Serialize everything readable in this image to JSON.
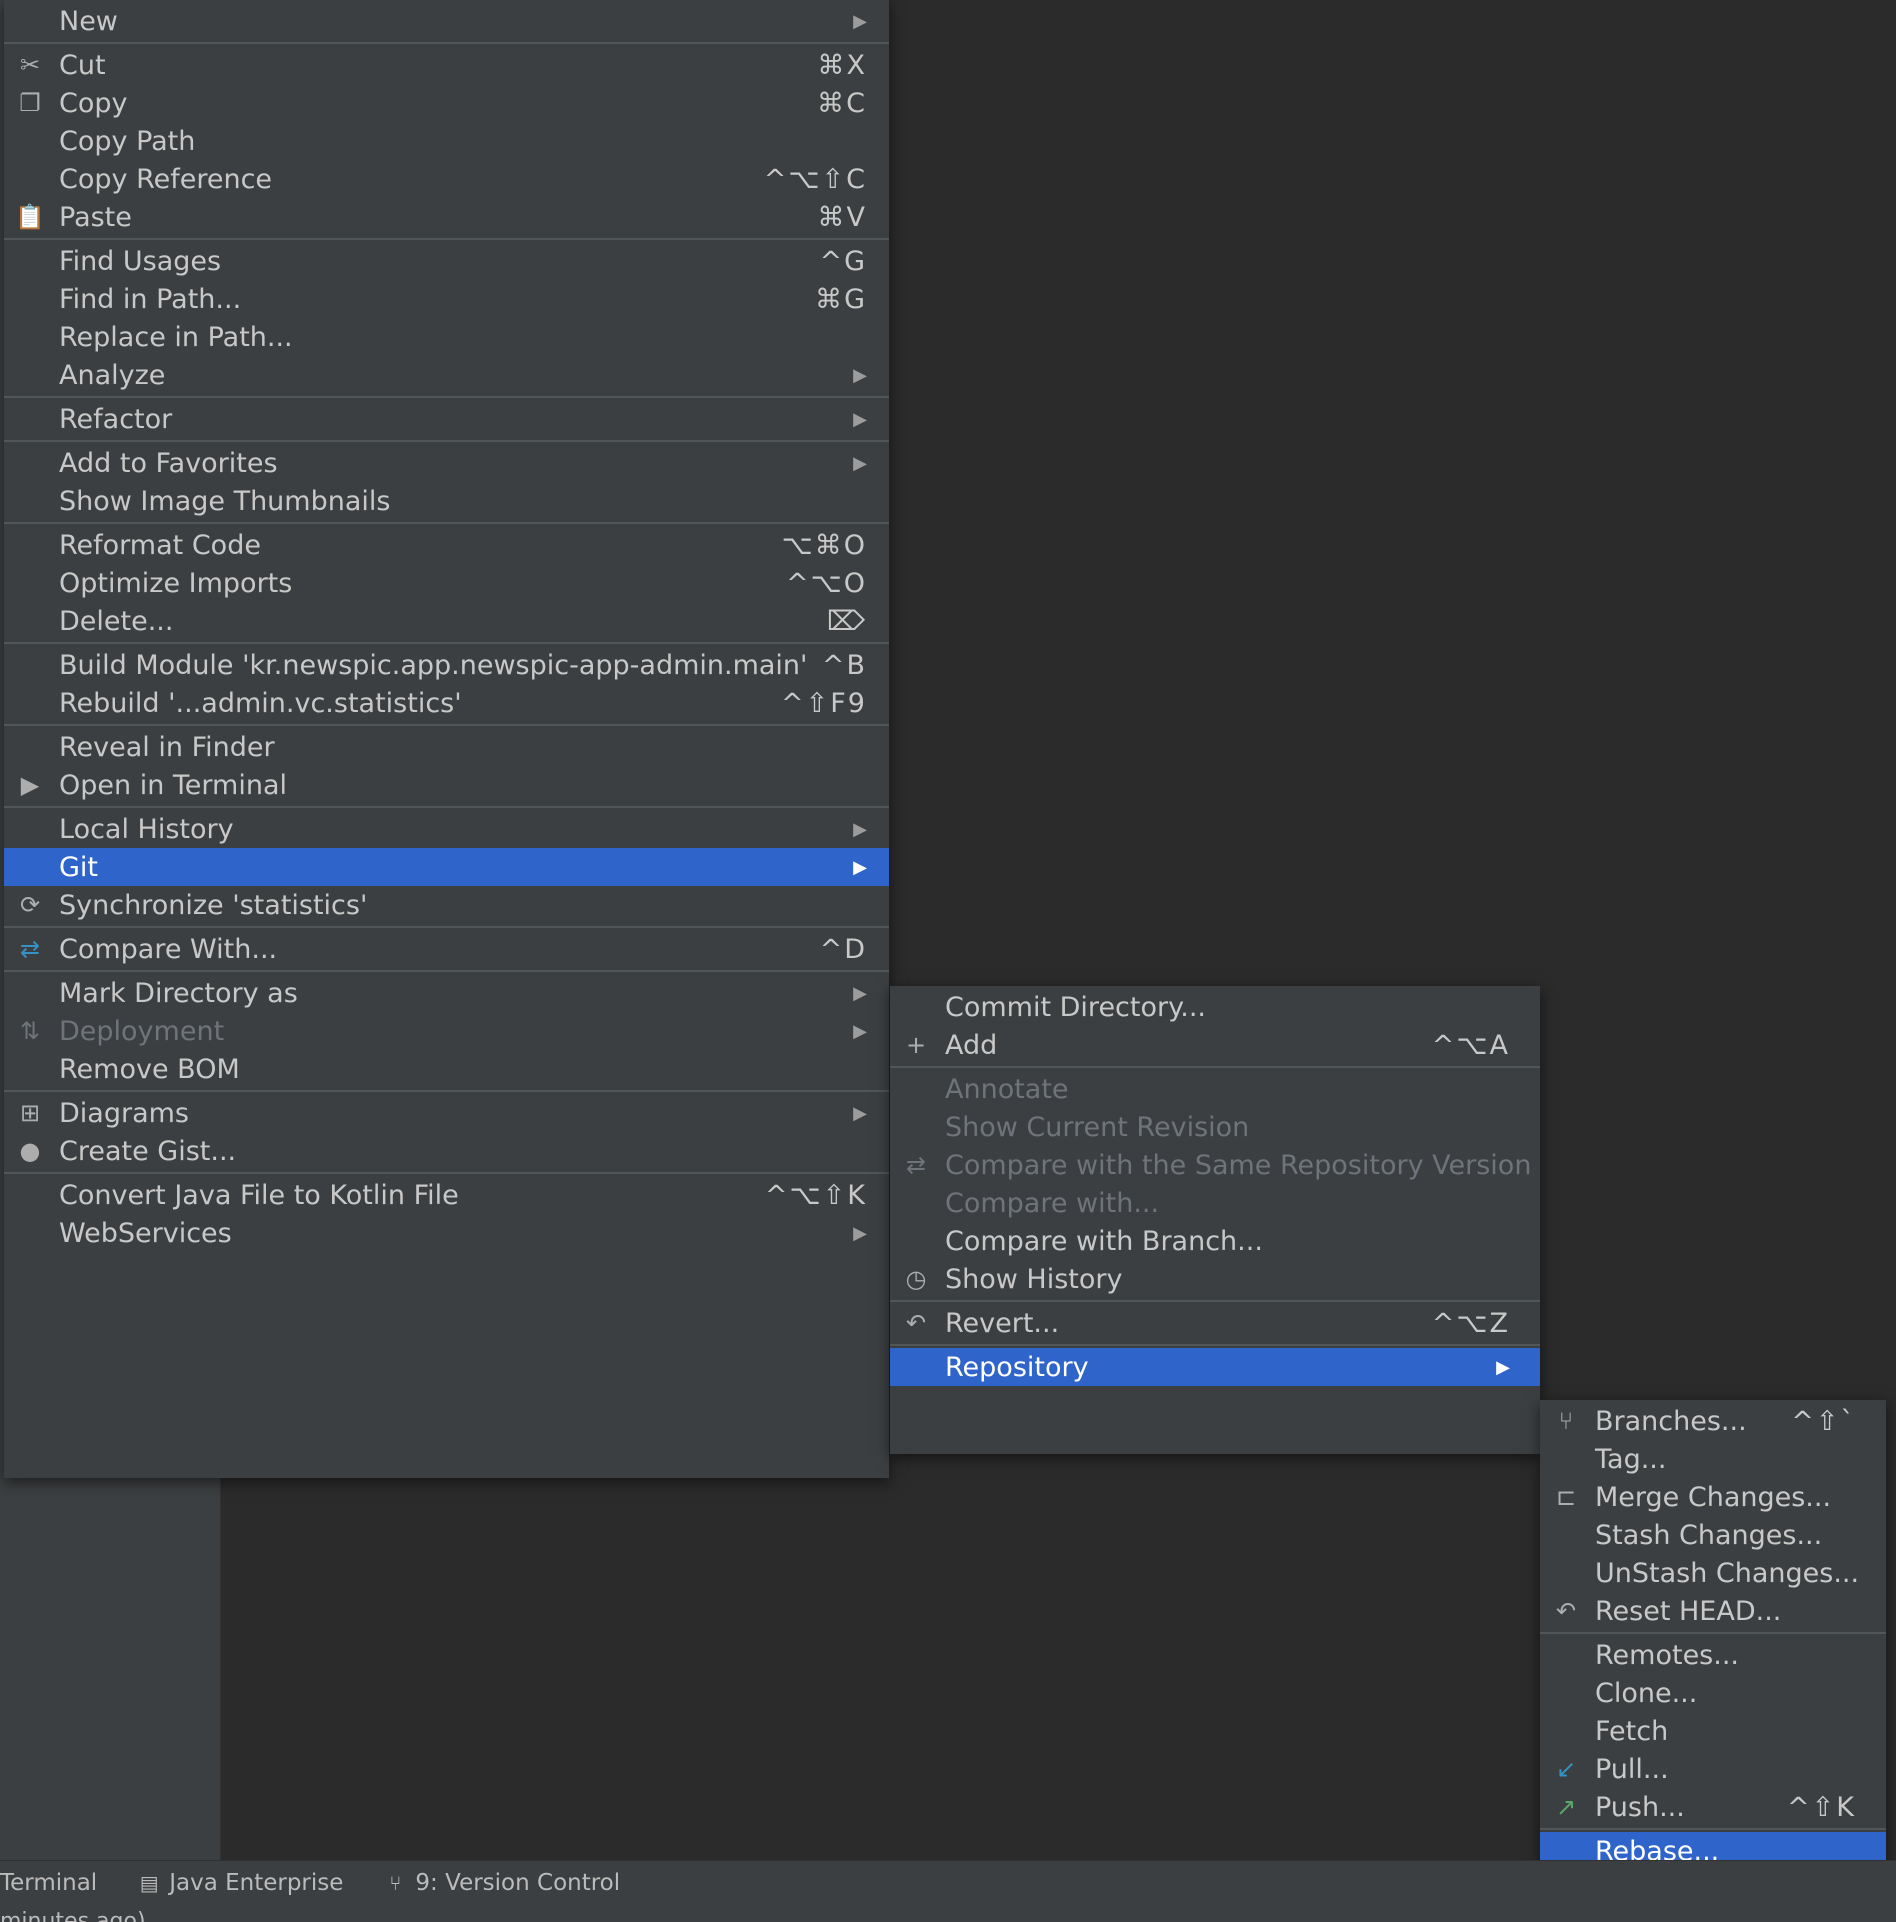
{
  "main_menu": {
    "items": [
      {
        "label": "New",
        "sub": true
      },
      {
        "sep": true
      },
      {
        "label": "Cut",
        "sc": "⌘X",
        "icon": "scissors-icon",
        "glyph": "✂"
      },
      {
        "label": "Copy",
        "sc": "⌘C",
        "icon": "copy-icon",
        "glyph": "❐"
      },
      {
        "label": "Copy Path"
      },
      {
        "label": "Copy Reference",
        "sc": "^⌥⇧C"
      },
      {
        "label": "Paste",
        "sc": "⌘V",
        "icon": "paste-icon",
        "glyph": "📋"
      },
      {
        "sep": true
      },
      {
        "label": "Find Usages",
        "sc": "^G"
      },
      {
        "label": "Find in Path...",
        "sc": "⌘G"
      },
      {
        "label": "Replace in Path..."
      },
      {
        "label": "Analyze",
        "sub": true
      },
      {
        "sep": true
      },
      {
        "label": "Refactor",
        "sub": true
      },
      {
        "sep": true
      },
      {
        "label": "Add to Favorites",
        "sub": true
      },
      {
        "label": "Show Image Thumbnails"
      },
      {
        "sep": true
      },
      {
        "label": "Reformat Code",
        "sc": "⌥⌘O"
      },
      {
        "label": "Optimize Imports",
        "sc": "^⌥O"
      },
      {
        "label": "Delete...",
        "sc": "⌦"
      },
      {
        "sep": true
      },
      {
        "label": "Build Module 'kr.newspic.app.newspic-app-admin.main'",
        "sc": "^B"
      },
      {
        "label": "Rebuild '...admin.vc.statistics'",
        "sc": "^⇧F9"
      },
      {
        "sep": true
      },
      {
        "label": "Reveal in Finder"
      },
      {
        "label": "Open in Terminal",
        "icon": "terminal-icon",
        "glyph": "▶"
      },
      {
        "sep": true
      },
      {
        "label": "Local History",
        "sub": true
      },
      {
        "label": "Git",
        "sub": true,
        "selected": true
      },
      {
        "label": "Synchronize 'statistics'",
        "icon": "sync-icon",
        "glyph": "⟳"
      },
      {
        "sep": true
      },
      {
        "label": "Compare With...",
        "sc": "^D",
        "icon": "compare-icon",
        "glyph": "⇄",
        "iconColor": "#3592c4"
      },
      {
        "sep": true
      },
      {
        "label": "Mark Directory as",
        "sub": true
      },
      {
        "label": "Deployment",
        "sub": true,
        "disabled": true,
        "icon": "deployment-icon",
        "glyph": "⇅"
      },
      {
        "label": "Remove BOM"
      },
      {
        "sep": true
      },
      {
        "label": "Diagrams",
        "sub": true,
        "icon": "diagram-icon",
        "glyph": "⊞"
      },
      {
        "label": "Create Gist...",
        "icon": "github-icon",
        "glyph": "●"
      },
      {
        "sep": true
      },
      {
        "label": "Convert Java File to Kotlin File",
        "sc": "^⌥⇧K"
      },
      {
        "label": "WebServices",
        "sub": true
      }
    ]
  },
  "git_menu": {
    "items": [
      {
        "label": "Commit Directory..."
      },
      {
        "label": "Add",
        "sc": "^⌥A",
        "icon": "plus-icon",
        "glyph": "+"
      },
      {
        "sep": true
      },
      {
        "label": "Annotate",
        "disabled": true
      },
      {
        "label": "Show Current Revision",
        "disabled": true
      },
      {
        "label": "Compare with the Same Repository Version",
        "disabled": true,
        "icon": "compare-icon",
        "glyph": "⇄"
      },
      {
        "label": "Compare with...",
        "disabled": true
      },
      {
        "label": "Compare with Branch..."
      },
      {
        "label": "Show History",
        "icon": "clock-icon",
        "glyph": "◷"
      },
      {
        "sep": true
      },
      {
        "label": "Revert...",
        "sc": "^⌥Z",
        "icon": "revert-icon",
        "glyph": "↶"
      },
      {
        "sep": true
      },
      {
        "label": "Repository",
        "sub": true,
        "selected": true
      }
    ]
  },
  "repo_menu": {
    "items": [
      {
        "label": "Branches...",
        "sc": "^⇧`",
        "icon": "branch-icon",
        "glyph": "⑂"
      },
      {
        "label": "Tag..."
      },
      {
        "label": "Merge Changes...",
        "icon": "merge-icon",
        "glyph": "⊏"
      },
      {
        "label": "Stash Changes..."
      },
      {
        "label": "UnStash Changes..."
      },
      {
        "label": "Reset HEAD...",
        "icon": "reset-icon",
        "glyph": "↶"
      },
      {
        "sep": true
      },
      {
        "label": "Remotes..."
      },
      {
        "label": "Clone..."
      },
      {
        "label": "Fetch"
      },
      {
        "label": "Pull...",
        "icon": "pull-icon",
        "glyph": "↙",
        "iconColor": "#3592c4"
      },
      {
        "label": "Push...",
        "sc": "^⇧K",
        "icon": "push-icon",
        "glyph": "↗",
        "iconColor": "#59a869"
      },
      {
        "sep": true
      },
      {
        "label": "Rebase...",
        "selected": true
      }
    ]
  },
  "bottom_toolbar": {
    "terminal": "Terminal",
    "java_enterprise": "Java Enterprise",
    "version_control": "9: Version Control"
  },
  "status_text": "minutes ago)"
}
